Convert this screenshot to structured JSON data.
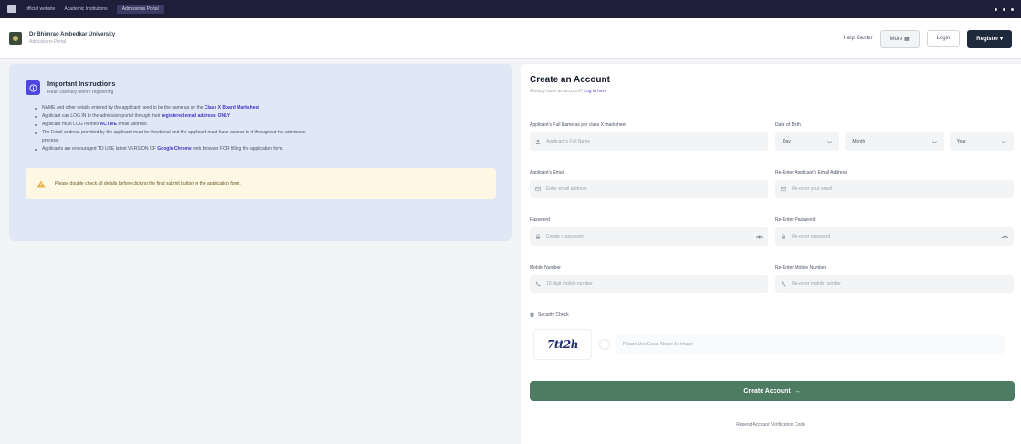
{
  "browser": {
    "tabs": [
      "official website",
      "Academic Institutions",
      "Admissions Portal"
    ]
  },
  "header": {
    "brand_name": "Dr Bhimrao Ambedkar University",
    "brand_sub": "Admissions Portal",
    "help_label": "Help Center",
    "menu_label": "More",
    "login_label": "Login",
    "register_label": "Register"
  },
  "instructions": {
    "title": "Important Instructions",
    "subtitle": "Read carefully before registering",
    "items": [
      {
        "pre": "NAME and other details entered by the applicant need to be the same as on the ",
        "bold": "Class X Board Marksheet",
        "post": ""
      },
      {
        "pre": "Applicant can LOG IN to the admission portal through their ",
        "bold": "registered email address, ONLY",
        "post": ""
      },
      {
        "pre": "Applicant must LOG IN their ",
        "bold": "ACTIVE",
        "post": " email address."
      },
      {
        "pre": "The Email address provided by the applicant must be functional and the applicant must have access to it throughout the admission",
        "bold": "",
        "post": ""
      },
      {
        "pre": "process.",
        "bold": "",
        "post": ""
      },
      {
        "pre": "Applicants are encouraged TO USE latest VERSION OF ",
        "bold": "Google Chrome",
        "post": " web browser FOR filling the application form."
      }
    ],
    "warning": "Please double check all details before clicking the final submit button in the application form."
  },
  "form": {
    "title": "Create an Account",
    "subtitle": "Already have an account?",
    "login_link": "Log in here",
    "fullname_label": "Applicant's Full Name as per class X marksheet",
    "fullname_placeholder": "Applicant's Full Name",
    "dob_label": "Date of Birth",
    "dob_day": "Day",
    "dob_month": "Month",
    "dob_year": "Year",
    "email_label": "Applicant's Email",
    "email_placeholder": "Enter email address",
    "reemail_label": "Re-Enter Applicant's Email Address",
    "reemail_placeholder": "Re-enter your email",
    "password_label": "Password",
    "password_placeholder": "Create a password",
    "repassword_label": "Re-Enter Password",
    "repassword_placeholder": "Re-enter password",
    "mobile_label": "Mobile Number",
    "mobile_placeholder": "10-digit mobile number",
    "remobile_label": "Re-Enter Mobile Number",
    "remobile_placeholder": "Re-enter mobile number",
    "security_label": "Security Check",
    "captcha_text": "7tt2h",
    "captcha_placeholder": "Please Use Exact Above As Image",
    "submit_label": "Create Account",
    "resend_label": "Resend Account Verification Code"
  },
  "colors": {
    "accent": "#4f46e5",
    "submit": "#4d7c63",
    "instruction_bg": "#e0e7f5",
    "warning_bg": "#fef7e3"
  }
}
